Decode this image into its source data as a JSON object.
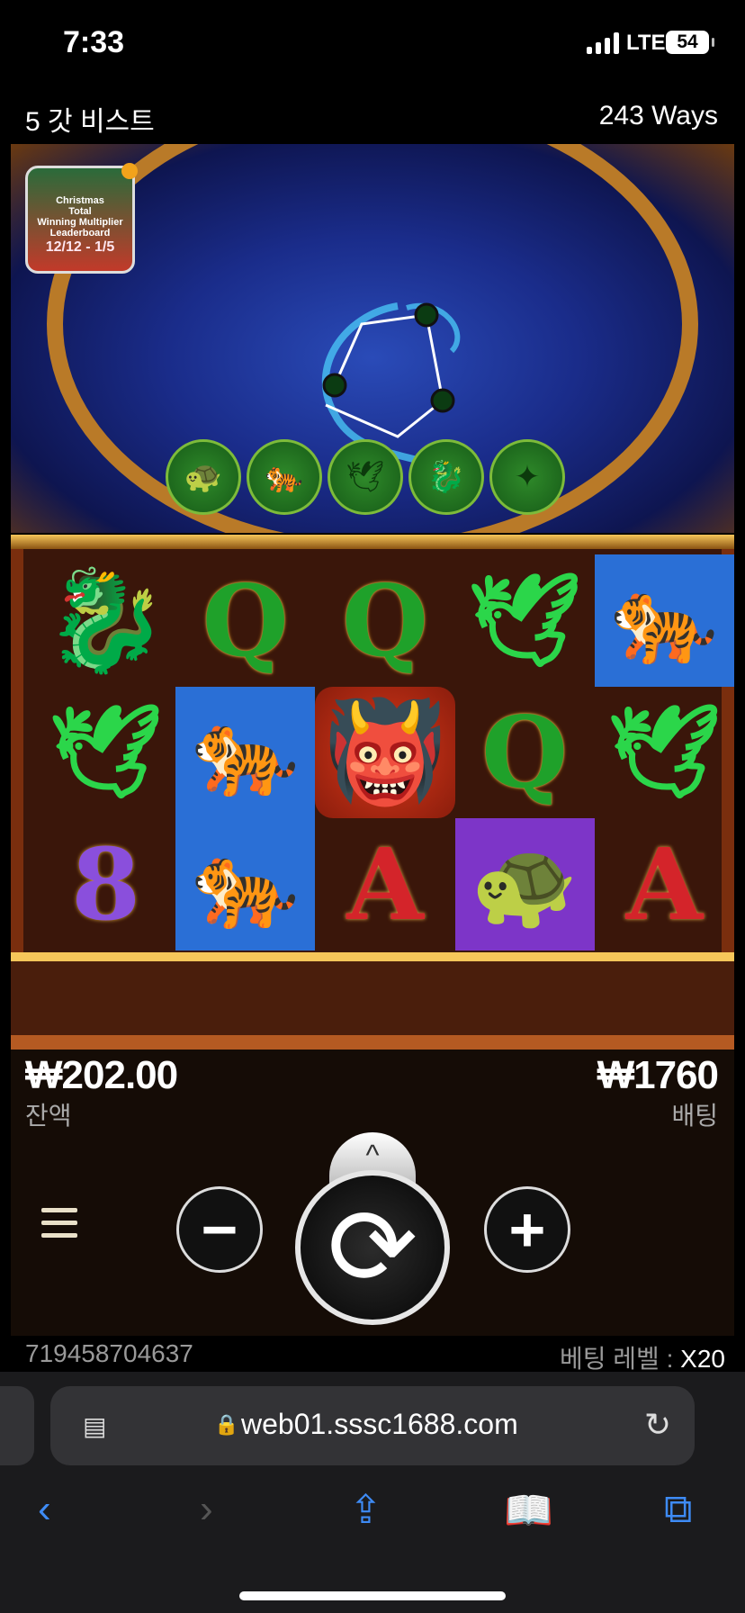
{
  "status_bar": {
    "time": "7:33",
    "network": "LTE",
    "battery": "54"
  },
  "game": {
    "title": "5 갓 비스트",
    "ways": "243 Ways"
  },
  "promo": {
    "line1": "Christmas",
    "line2": "Total",
    "line3": "Winning Multiplier",
    "line4": "Leaderboard",
    "date": "12/12 - 1/5"
  },
  "collection_icons": [
    "turtle-coin-icon",
    "tiger-coin-icon",
    "crane-coin-icon",
    "dragon-coin-icon",
    "phoenix-coin-icon"
  ],
  "reels": [
    {
      "label": "dragon-symbol",
      "glyph": "🐉",
      "cls": "s-dragon"
    },
    {
      "label": "q-symbol",
      "glyph": "Q",
      "cls": "s-q"
    },
    {
      "label": "q-symbol",
      "glyph": "Q",
      "cls": "s-q"
    },
    {
      "label": "crane-symbol",
      "glyph": "🕊",
      "cls": "s-crane"
    },
    {
      "label": "tiger-symbol",
      "glyph": "🐅",
      "cls": "s-tiger"
    },
    {
      "label": "crane-symbol",
      "glyph": "🕊",
      "cls": "s-crane"
    },
    {
      "label": "tiger-symbol",
      "glyph": "🐅",
      "cls": "s-tiger"
    },
    {
      "label": "dragon-mask-symbol",
      "glyph": "👹",
      "cls": "s-mask"
    },
    {
      "label": "q-symbol",
      "glyph": "Q",
      "cls": "s-q"
    },
    {
      "label": "crane-symbol",
      "glyph": "🕊",
      "cls": "s-crane"
    },
    {
      "label": "eight-symbol",
      "glyph": "8",
      "cls": "s-8"
    },
    {
      "label": "tiger-symbol",
      "glyph": "🐅",
      "cls": "s-tiger"
    },
    {
      "label": "a-symbol",
      "glyph": "A",
      "cls": "s-a"
    },
    {
      "label": "turtle-symbol",
      "glyph": "🐢",
      "cls": "s-turtle"
    },
    {
      "label": "a-symbol",
      "glyph": "A",
      "cls": "s-a"
    }
  ],
  "balance": {
    "value": "₩202.00",
    "label": "잔액"
  },
  "bet": {
    "value": "₩1760",
    "label": "배팅"
  },
  "controls": {
    "minus": "−",
    "plus": "+",
    "spin_icon": "⟳",
    "expand_icon": "^"
  },
  "footer": {
    "transaction_id": "719458704637",
    "bet_level_label": "베팅 레벨 :",
    "bet_level_value": "X20"
  },
  "browser": {
    "url": "web01.sssc1688.com"
  }
}
